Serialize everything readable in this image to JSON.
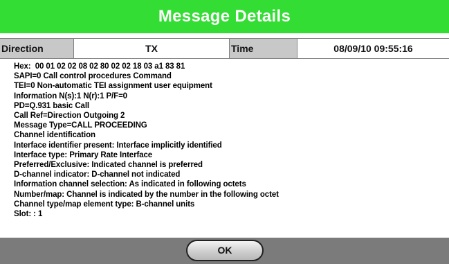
{
  "dialog": {
    "title": "Message Details"
  },
  "info_row": {
    "direction_label": "Direction",
    "direction_value": "TX",
    "time_label": "Time",
    "time_value": "08/09/10 09:55:16"
  },
  "details": {
    "lines": [
      "Hex:  00 01 02 02 08 02 80 02 02 18 03 a1 83 81",
      "SAPI=0 Call control procedures Command",
      "TEI=0 Non-automatic TEI assignment user equipment",
      "Information N(s):1 N(r):1 P/F=0",
      "PD=Q.931 basic Call",
      "Call Ref=Direction Outgoing 2",
      "Message Type=CALL PROCEEDING",
      "Channel identification",
      "Interface identifier present: Interface implicitly identified",
      "Interface type: Primary Rate Interface",
      "Preferred/Exclusive: Indicated channel is preferred",
      "D-channel indicator: D-channel not indicated",
      "Information channel selection: As indicated in following octets",
      "Number/map: Channel is indicated by the number in the following octet",
      "Channel type/map element type: B-channel units",
      "Slot: : 1"
    ]
  },
  "footer": {
    "ok_label": "OK"
  },
  "colors": {
    "title_bar": "#33dd33",
    "label_cell": "#c8c8c8",
    "bottom_bar": "#7b7b7b"
  }
}
